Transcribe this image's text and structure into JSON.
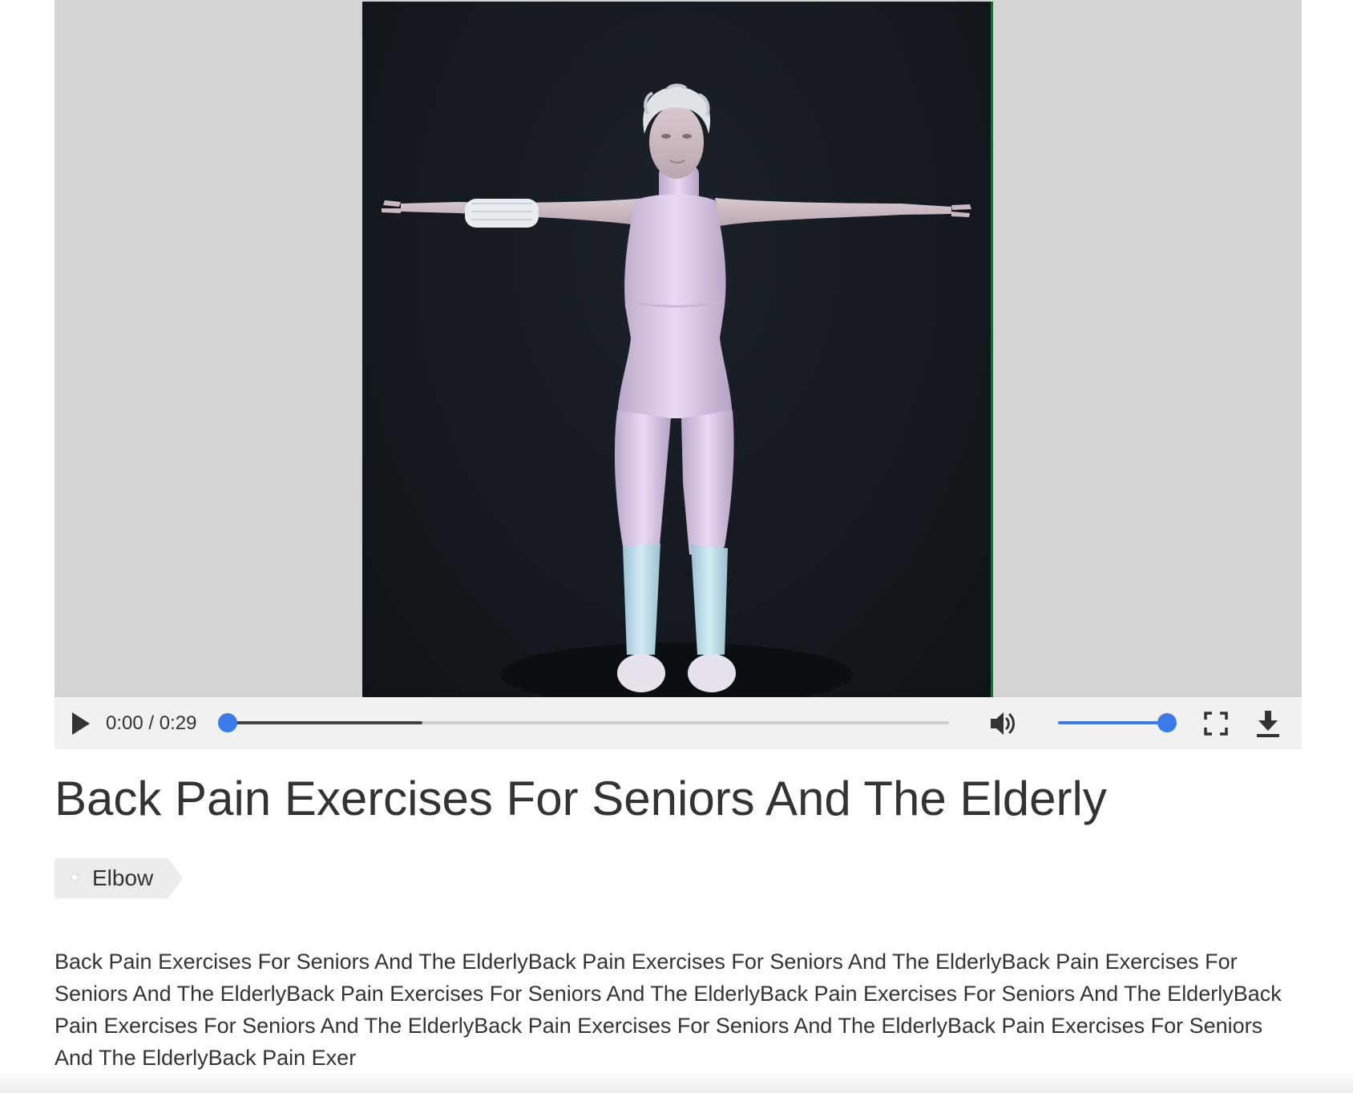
{
  "video": {
    "time_display": "0:00 / 0:29",
    "progress_fraction": 0.0,
    "buffered_fraction": 0.27,
    "volume_fraction": 1.0,
    "accent_color": "#3b7bea",
    "icons": {
      "play": "play-icon",
      "mute": "volume-icon",
      "fullscreen": "fullscreen-icon",
      "download": "download-icon"
    }
  },
  "page": {
    "title": "Back Pain Exercises For Seniors And The Elderly"
  },
  "tag": {
    "label": "Elbow",
    "icon": "tag-icon"
  },
  "description": "Back Pain Exercises For Seniors And The ElderlyBack Pain Exercises For Seniors And The ElderlyBack Pain Exercises For Seniors And The ElderlyBack Pain Exercises For Seniors And The ElderlyBack Pain Exercises For Seniors And The ElderlyBack Pain Exercises For Seniors And The ElderlyBack Pain Exercises For Seniors And The ElderlyBack Pain Exercises For Seniors And The ElderlyBack Pain Exer"
}
